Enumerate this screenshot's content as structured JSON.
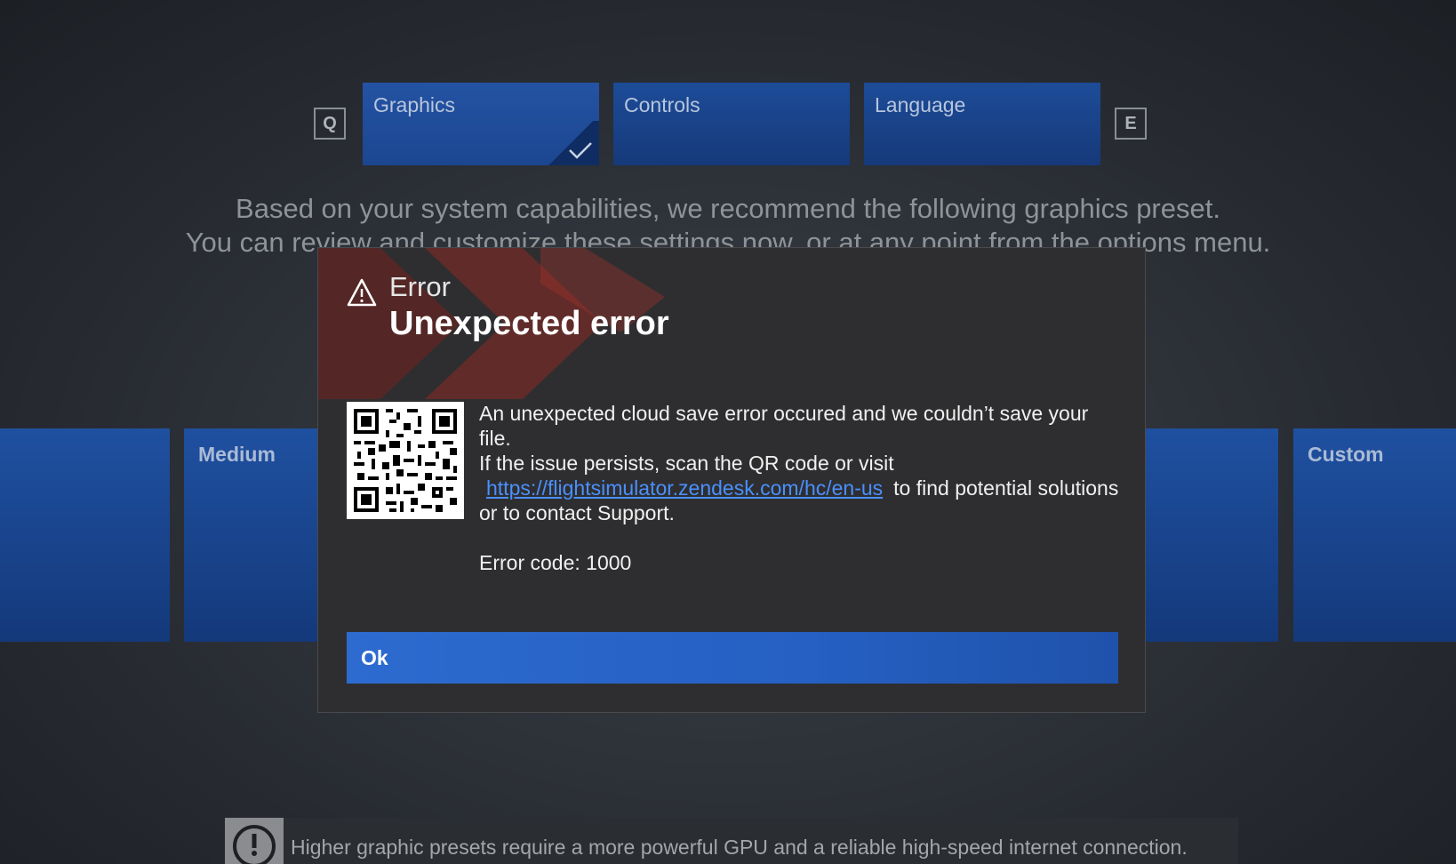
{
  "tabs": {
    "prev_key": "Q",
    "next_key": "E",
    "items": [
      {
        "label": "Graphics"
      },
      {
        "label": "Controls"
      },
      {
        "label": "Language"
      }
    ]
  },
  "recommendation": {
    "line1": "Based on your system capabilities, we recommend the following graphics preset.",
    "line2": "You can review and customize these settings now, or at any point from the options menu."
  },
  "presets": {
    "medium": "Medium",
    "custom": "Custom"
  },
  "dialog": {
    "kicker": "Error",
    "title": "Unexpected error",
    "message1": "An unexpected cloud save error occured and we couldn’t save your file.",
    "message2_prefix": "If the issue persists, scan the QR code or visit",
    "link": "https://flightsimulator.zendesk.com/hc/en-us",
    "message2_suffix": "to find potential solutions or to contact Support.",
    "error_code": "Error code: 1000",
    "ok_label": "Ok"
  },
  "notice": {
    "text": "Higher graphic presets require a more powerful GPU and a reliable high-speed internet connection."
  },
  "colors": {
    "accent_blue": "#2d6bd0",
    "link_blue": "#4a90ff",
    "warning_red": "#b0302a"
  }
}
